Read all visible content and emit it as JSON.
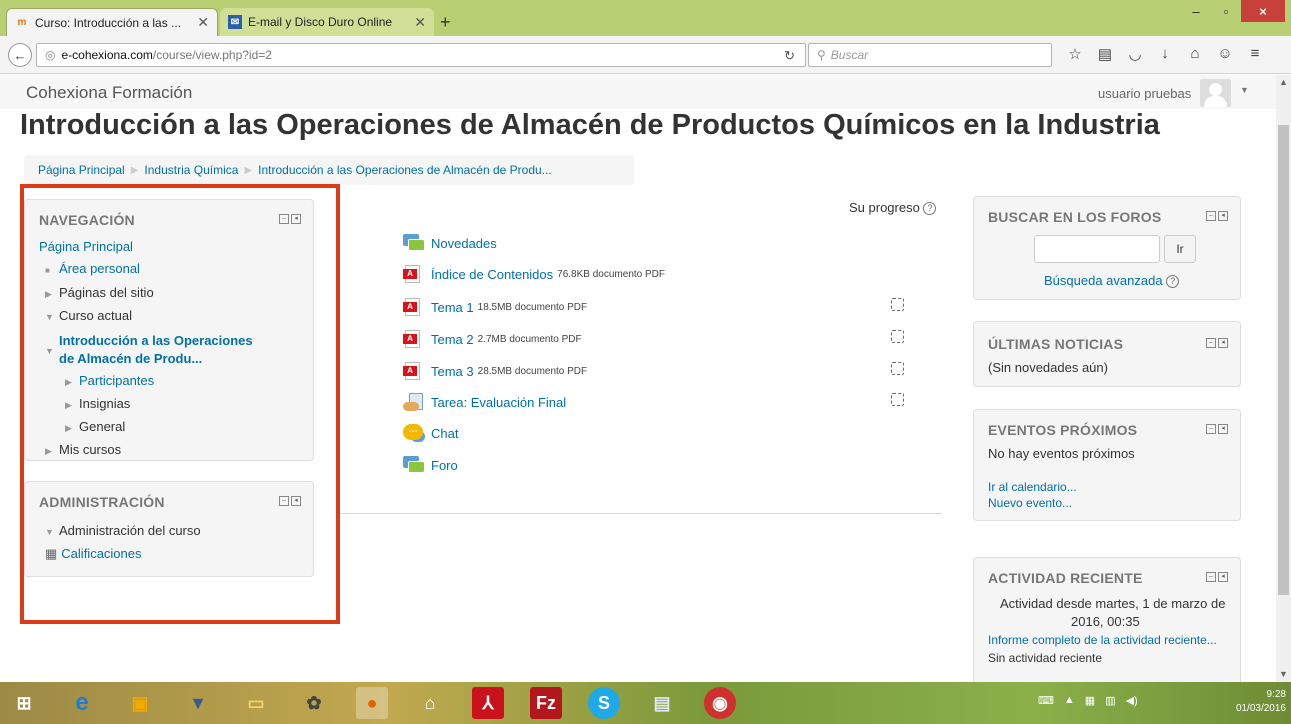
{
  "browser": {
    "tabs": [
      {
        "label": "Curso: Introducción a las ...",
        "icon": "moodle-icon",
        "active": true
      },
      {
        "label": "E-mail y Disco Duro Online",
        "icon": "mail-icon",
        "active": false
      }
    ],
    "new_tab": "+",
    "url_domain": "e-cohexiona.com",
    "url_path": "/course/view.php?id=2",
    "search_placeholder": "Buscar",
    "window_buttons": [
      "–",
      "▫",
      "×"
    ],
    "toolbar_icons": [
      "star-icon",
      "bookmarks-icon",
      "pocket-icon",
      "download-icon",
      "home-icon",
      "chat-icon",
      "menu-icon"
    ]
  },
  "site": {
    "name": "Cohexiona Formación",
    "user": "usuario pruebas",
    "course_title": "Introducción a las Operaciones de Almacén de Productos Químicos en la Industria"
  },
  "breadcrumb": [
    "Página Principal",
    "Industria Química",
    "Introducción a las Operaciones de Almacén de Produ..."
  ],
  "navigation": {
    "title": "NAVEGACIÓN",
    "home": "Página Principal",
    "area_personal": "Área personal",
    "paginas_sitio": "Páginas del sitio",
    "curso_actual": "Curso actual",
    "current_course_line1": "Introducción a las Operaciones",
    "current_course_line2": "de Almacén de Produ...",
    "participantes": "Participantes",
    "insignias": "Insignias",
    "general": "General",
    "mis_cursos": "Mis cursos"
  },
  "administration": {
    "title": "ADMINISTRACIÓN",
    "course_admin": "Administración del curso",
    "grades": "Calificaciones"
  },
  "course": {
    "progress_label": "Su progreso",
    "activities": [
      {
        "name": "Novedades",
        "meta": "",
        "type": "forum"
      },
      {
        "name": "Índice de Contenidos",
        "meta": "76.8KB documento PDF",
        "type": "pdf"
      },
      {
        "name": "Tema 1",
        "meta": "18.5MB documento PDF",
        "type": "pdf"
      },
      {
        "name": "Tema 2",
        "meta": "2.7MB documento PDF",
        "type": "pdf"
      },
      {
        "name": "Tema 3",
        "meta": "28.5MB documento PDF",
        "type": "pdf"
      },
      {
        "name": "Tarea: Evaluación Final",
        "meta": "",
        "type": "assign"
      },
      {
        "name": "Chat",
        "meta": "",
        "type": "chat"
      },
      {
        "name": "Foro",
        "meta": "",
        "type": "forum"
      }
    ]
  },
  "blocks": {
    "search_forums": {
      "title": "BUSCAR EN LOS FOROS",
      "go": "Ir",
      "advanced": "Búsqueda avanzada"
    },
    "news": {
      "title": "ÚLTIMAS NOTICIAS",
      "text": "(Sin novedades aún)"
    },
    "events": {
      "title": "EVENTOS PRÓXIMOS",
      "text": "No hay eventos próximos",
      "calendar": "Ir al calendario...",
      "new_event": "Nuevo evento..."
    },
    "recent": {
      "title": "ACTIVIDAD RECIENTE",
      "since_line1": "Actividad desde martes, 1 de marzo de",
      "since_line2": "2016, 00:35",
      "full_report": "Informe completo de la actividad reciente...",
      "none": "Sin actividad reciente"
    }
  },
  "taskbar": {
    "apps": [
      "windows-start-icon",
      "internet-explorer-icon",
      "store-icon",
      "pin-icon",
      "file-explorer-icon",
      "media-icon",
      "firefox-icon",
      "home-icon",
      "acrobat-icon",
      "filezilla-icon",
      "skype-icon",
      "files-icon",
      "camera-icon"
    ],
    "time": "9:28",
    "date": "01/03/2016"
  }
}
